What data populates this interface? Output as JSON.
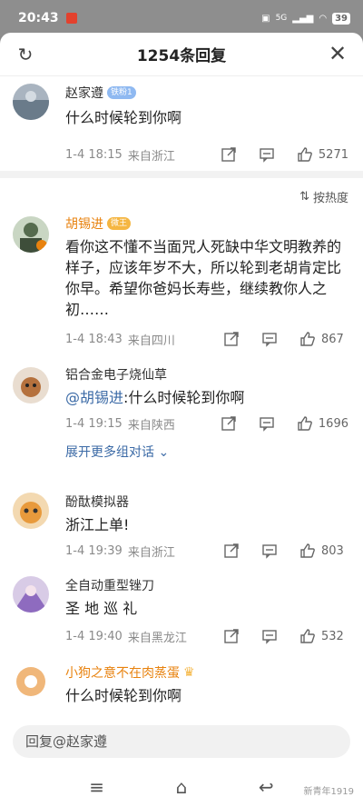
{
  "status": {
    "time": "20:43",
    "signal": "5G",
    "battery": "39"
  },
  "header": {
    "title": "1254条回复"
  },
  "top_comment": {
    "name": "赵家遵",
    "badge": "铁粉1",
    "text": "什么时候轮到你啊",
    "date": "1-4 18:15",
    "location": "来自浙江",
    "likes": "5271"
  },
  "sort": {
    "label": "按热度"
  },
  "comments": [
    {
      "name": "胡锡进",
      "badge": "微王",
      "text": "看你这不懂不当面咒人死缺中华文明教养的样子，应该年岁不大，所以轮到老胡肯定比你早。希望你爸妈长寿些，继续教你人之初……",
      "date": "1-4 18:43",
      "location": "来自四川",
      "likes": "867"
    },
    {
      "name": "铝合金电子烧仙草",
      "mention": "@胡锡进",
      "text": ":什么时候轮到你啊",
      "date": "1-4 19:15",
      "location": "来自陕西",
      "likes": "1696",
      "expand": "展开更多组对话"
    },
    {
      "name": "酚酞模拟器",
      "text": "浙江上单!",
      "date": "1-4 19:39",
      "location": "来自浙江",
      "likes": "803"
    },
    {
      "name": "全自动重型锉刀",
      "text": "圣 地 巡 礼",
      "date": "1-4 19:40",
      "location": "来自黑龙江",
      "likes": "532"
    },
    {
      "name": "小狗之意不在肉蒸蛋",
      "text": "什么时候轮到你啊"
    }
  ],
  "reply": {
    "placeholder": "回复@赵家遵"
  },
  "watermark": "新青年1919"
}
